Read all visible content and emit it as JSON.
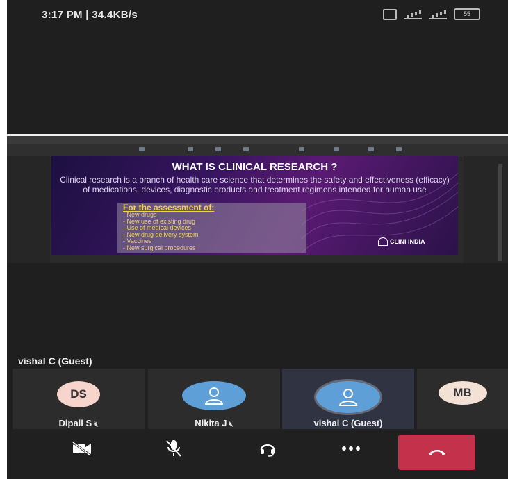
{
  "status_bar": {
    "time_speed": "3:17 PM | 34.4KB/s",
    "battery": "55"
  },
  "slide": {
    "title": "WHAT IS CLINICAL RESEARCH ?",
    "description": "Clinical research is a branch of health care science that determines the safety and effectiveness (efficacy) of medications, devices, diagnostic products and treatment regimens intended for human use",
    "box_heading": "For the assessment of:",
    "box_items": [
      "- New drugs",
      "- New use of existing drug",
      "- Use of medical devices",
      "- New drug delivery system",
      "- Vaccines",
      "- New surgical procedures"
    ],
    "logo_text": "CLINI INDIA"
  },
  "speaker_label": "vishal C (Guest)",
  "participants": [
    {
      "initials": "DS",
      "name": "Dipali S"
    },
    {
      "initials": "",
      "name": "Nikita J"
    },
    {
      "initials": "",
      "name": "vishal C (Guest)"
    },
    {
      "initials": "MB",
      "name": ""
    }
  ],
  "controls": {
    "camera": "camera-off-icon",
    "mic": "mic-off-icon",
    "audio": "headset-icon",
    "more": "more-icon",
    "hangup": "hang-up-icon"
  },
  "colors": {
    "hangup": "#c4314b",
    "avatar_blue": "#5f9fd8",
    "slide_accent": "#f3d43b"
  }
}
